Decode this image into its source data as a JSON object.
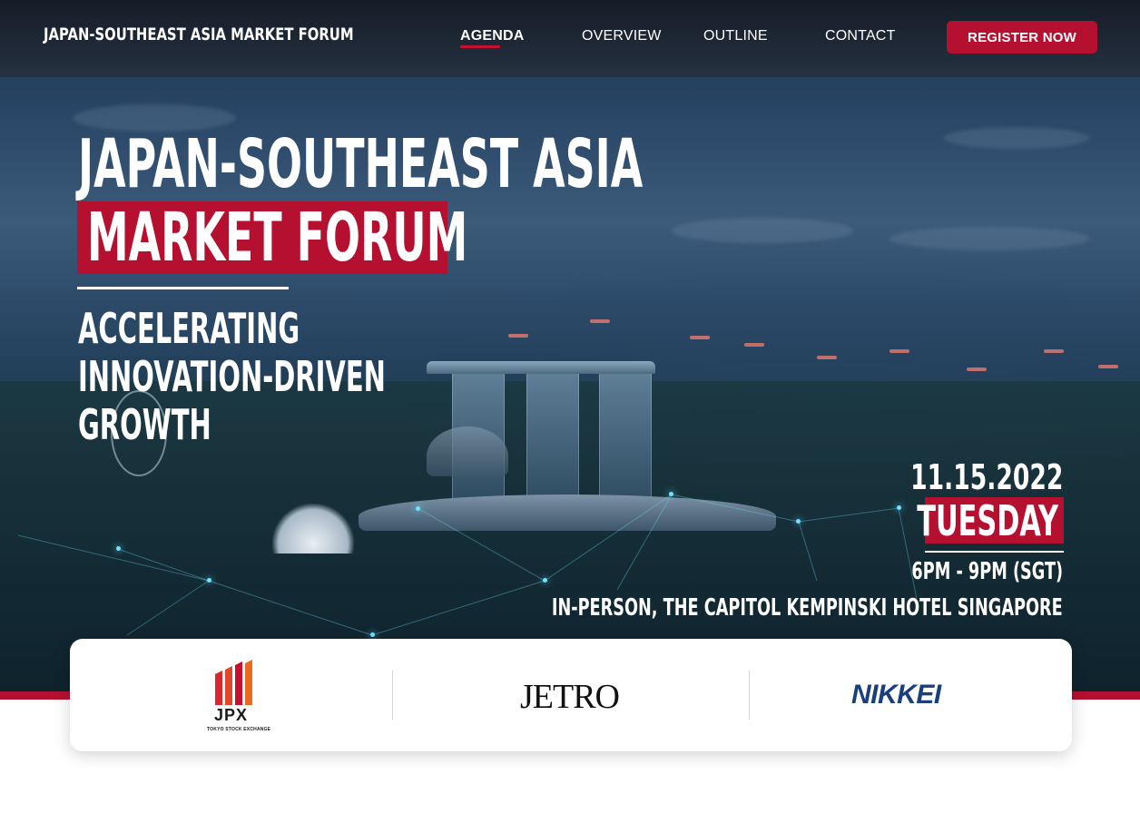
{
  "nav": {
    "brand": "JAPAN-SOUTHEAST ASIA MARKET FORUM",
    "links": [
      {
        "label": "AGENDA",
        "active": true
      },
      {
        "label": "OVERVIEW",
        "active": false
      },
      {
        "label": "OUTLINE",
        "active": false
      },
      {
        "label": "CONTACT",
        "active": false
      }
    ],
    "cta": "REGISTER NOW"
  },
  "hero": {
    "title_line1": "JAPAN-SOUTHEAST ASIA",
    "title_line2": "MARKET FORUM",
    "tagline": [
      "ACCELERATING",
      "INNOVATION-DRIVEN",
      "GROWTH"
    ],
    "date": "11.15.2022",
    "day": "TUESDAY",
    "time": "6PM - 9PM (SGT)",
    "venue": "IN-PERSON, THE CAPITOL KEMPINSKI HOTEL SINGAPORE"
  },
  "partners": {
    "jpx": {
      "name": "JPX",
      "subtitle": "TOKYO STOCK EXCHANGE"
    },
    "jetro": {
      "name": "JETRO"
    },
    "nikkei": {
      "name": "NIKKEI"
    }
  },
  "colors": {
    "accent": "#b5102f",
    "nav_bg": "#1a222e",
    "nikkei_blue": "#1b3f7a"
  }
}
